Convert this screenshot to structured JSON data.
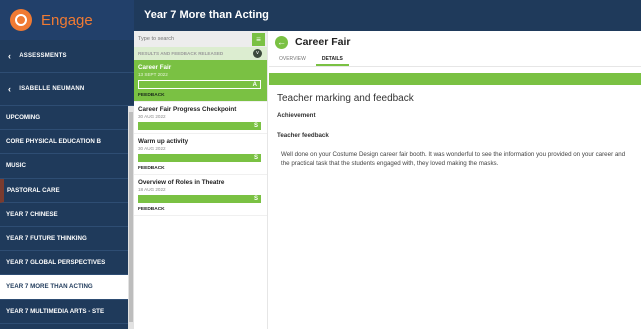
{
  "app": {
    "brand": "Engage",
    "header_title": "Year 7 More than Acting"
  },
  "nav": {
    "back_links": [
      "ASSESSMENTS",
      "ISABELLE NEUMANN"
    ],
    "items": [
      {
        "label": "UPCOMING",
        "marked": false,
        "active": false
      },
      {
        "label": "CORE PHYSICAL EDUCATION B",
        "marked": false,
        "active": false
      },
      {
        "label": "MUSIC",
        "marked": false,
        "active": false
      },
      {
        "label": "PASTORAL CARE",
        "marked": true,
        "active": false
      },
      {
        "label": "YEAR 7 CHINESE",
        "marked": false,
        "active": false
      },
      {
        "label": "YEAR 7 FUTURE THINKING",
        "marked": false,
        "active": false
      },
      {
        "label": "YEAR 7 GLOBAL PERSPECTIVES",
        "marked": false,
        "active": false
      },
      {
        "label": "YEAR 7 MORE THAN ACTING",
        "marked": false,
        "active": true
      },
      {
        "label": "YEAR 7 MULTIMEDIA ARTS - STE",
        "marked": false,
        "active": false
      }
    ]
  },
  "tasks_panel": {
    "search_placeholder": "Type to search",
    "filter_icon": "filter-icon",
    "results_label": "RESULTS AND FEEDBACK RELEASED",
    "collapse_icon": "chevron-down-icon",
    "tasks": [
      {
        "title": "Career Fair",
        "date": "13 SEPT 2022",
        "grade": "A",
        "feedback": "FEEDBACK",
        "selected": true
      },
      {
        "title": "Career Fair Progress Checkpoint",
        "date": "30 AUG 2022",
        "grade": "S",
        "feedback": "",
        "selected": false
      },
      {
        "title": "Warm up activity",
        "date": "30 AUG 2022",
        "grade": "S",
        "feedback": "FEEDBACK",
        "selected": false
      },
      {
        "title": "Overview of Roles in Theatre",
        "date": "18 AUG 2022",
        "grade": "S",
        "feedback": "FEEDBACK",
        "selected": false
      }
    ]
  },
  "detail": {
    "title": "Career Fair",
    "tabs": [
      {
        "label": "OVERVIEW",
        "active": false
      },
      {
        "label": "DETAILS",
        "active": true
      }
    ],
    "section_title": "Teacher marking and feedback",
    "achievement_label": "Achievement",
    "feedback_label": "Teacher feedback",
    "feedback_text": "Well done on your Costume Design career fair booth. It was wonderful to see the information you provided on your career and the practical task that the students engaged with, they loved making the masks."
  },
  "colors": {
    "nav_bg": "#1f3a5b",
    "accent_green": "#7ac143",
    "brand_orange": "#f07a33"
  }
}
